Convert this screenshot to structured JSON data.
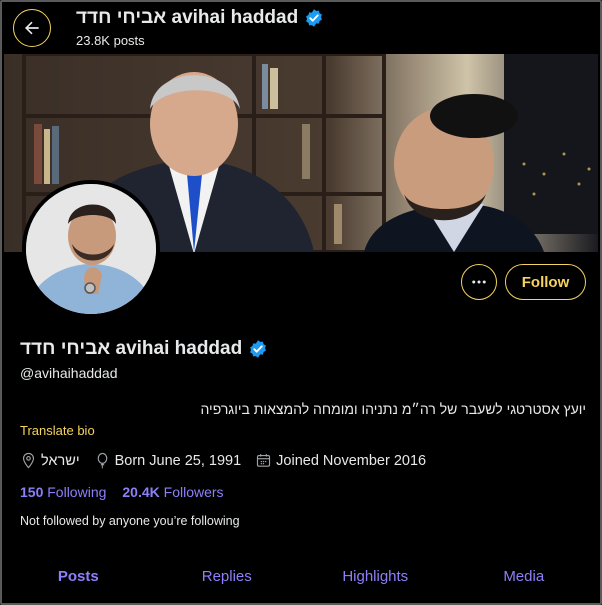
{
  "header": {
    "display_name": "אביחי חדד avihai haddad",
    "posts_count": "23.8K posts"
  },
  "profile": {
    "display_name": "אביחי חדד avihai haddad",
    "handle": "@avihaihaddad",
    "bio": "יועץ אסטרטגי לשעבר של רה״מ נתניהו ומומחה להמצאות ביוגרפיה",
    "translate_label": "Translate bio",
    "location": "ישראל",
    "birth": "Born June 25, 1991",
    "joined": "Joined November 2016",
    "following_count": "150",
    "following_label": "Following",
    "followers_count": "20.4K",
    "followers_label": "Followers",
    "not_followed_note": "Not followed by anyone you’re following",
    "verified": true
  },
  "actions": {
    "follow_label": "Follow",
    "more_icon": "ellipsis-icon",
    "back_icon": "arrow-left-icon"
  },
  "tabs": [
    {
      "label": "Posts",
      "active": true
    },
    {
      "label": "Replies",
      "active": false
    },
    {
      "label": "Highlights",
      "active": false
    },
    {
      "label": "Media",
      "active": false
    }
  ],
  "colors": {
    "background": "#000000",
    "accent_yellow": "#f4d35e",
    "link_purple": "#8b80f9",
    "verified_blue": "#1d9bf0",
    "text": "#e7e9ea"
  }
}
